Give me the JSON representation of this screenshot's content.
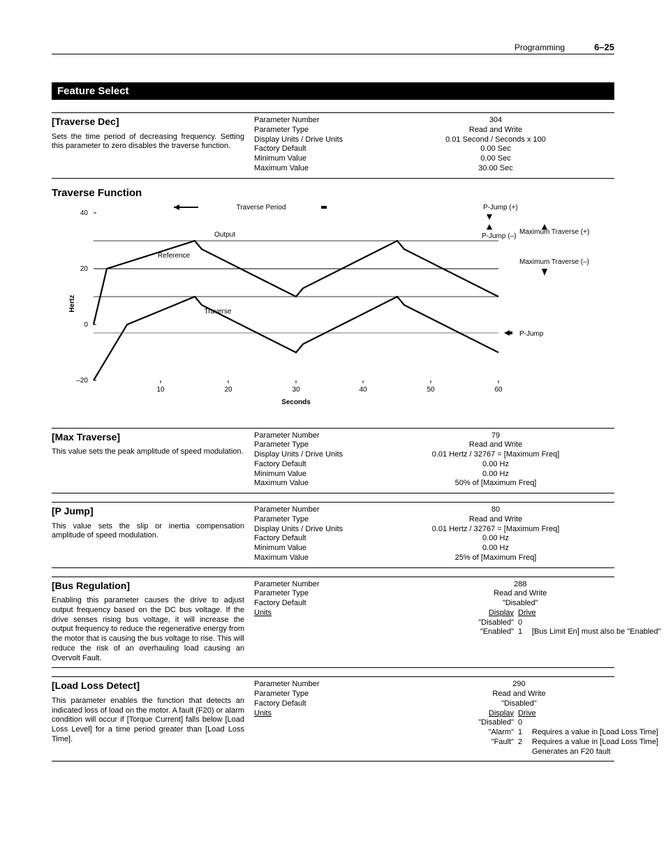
{
  "page_header": {
    "section": "Programming",
    "page_number": "6–25"
  },
  "feature_bar": "Feature Select",
  "traverse_dec": {
    "title": "[Traverse Dec]",
    "desc": "Sets the time period of decreasing frequency. Setting this parameter to zero disables the traverse function.",
    "labels": {
      "pn": "Parameter Number",
      "pt": "Parameter Type",
      "du": "Display Units / Drive Units",
      "fd": "Factory Default",
      "min": "Minimum Value",
      "max": "Maximum Value"
    },
    "values": {
      "pn": "304",
      "pt": "Read and Write",
      "du": "0.01 Second / Seconds x 100",
      "fd": "0.00 Sec",
      "min": "0.00 Sec",
      "max": "30.00 Sec"
    }
  },
  "diagram": {
    "title": "Traverse Function",
    "xlabel": "Seconds",
    "ylabel": "Hertz",
    "annotations": {
      "traverse_period": "Traverse Period",
      "output": "Output",
      "reference": "Reference",
      "traverse": "Traverse",
      "pjump_plus": "P-Jump (+)",
      "pjump_minus": "P-Jump (–)",
      "max_traverse_plus": "Maximum Traverse (+)",
      "max_traverse_minus": "Maximum Traverse (–)",
      "pjump": "P-Jump"
    },
    "yticks": [
      "–20",
      "0",
      "20",
      "40"
    ],
    "xticks": [
      "10",
      "20",
      "30",
      "40",
      "50",
      "60"
    ]
  },
  "max_traverse": {
    "title": "[Max Traverse]",
    "desc": "This value sets the peak amplitude of speed modulation.",
    "values": {
      "pn": "79",
      "pt": "Read and Write",
      "du": "0.01 Hertz / 32767 = [Maximum Freq]",
      "fd": "0.00 Hz",
      "min": "0.00 Hz",
      "max": "50% of [Maximum Freq]"
    }
  },
  "p_jump": {
    "title": "[P Jump]",
    "desc": "This value sets the slip or inertia compensation amplitude of speed modulation.",
    "values": {
      "pn": "80",
      "pt": "Read and Write",
      "du": "0.01 Hertz / 32767 = [Maximum Freq]",
      "fd": "0.00 Hz",
      "min": "0.00 Hz",
      "max": "25% of [Maximum Freq]"
    }
  },
  "bus_reg": {
    "title": "[Bus Regulation]",
    "desc": "Enabling this parameter causes the drive to adjust output frequency based on the DC bus voltage. If the drive senses rising bus voltage, it will increase the output frequency to reduce the regenerative energy from the motor that is causing the bus voltage to rise. This will reduce the risk of an overhauling load causing an Overvolt Fault.",
    "labels": {
      "units": "Units"
    },
    "values": {
      "pn": "288",
      "pt": "Read and Write",
      "fd": "\"Disabled\"",
      "units_h1": "Display",
      "units_h2": "Drive",
      "u0a": "\"Disabled\"",
      "u0b": "0",
      "u1a": "\"Enabled\"",
      "u1b": "1",
      "u1n": "[Bus Limit En] must also be \"Enabled\""
    }
  },
  "load_loss": {
    "title": "[Load Loss Detect]",
    "desc": "This parameter enables the function that detects an indicated loss of load on the motor. A fault (F20) or alarm condition will occur if [Torque Current] falls below [Load Loss Level] for a time period greater than [Load Loss Time].",
    "values": {
      "pn": "290",
      "pt": "Read and Write",
      "fd": "\"Disabled\"",
      "units_h1": "Display",
      "units_h2": "Drive",
      "u0a": "\"Disabled\"",
      "u0b": "0",
      "u1a": "\"Alarm\"",
      "u1b": "1",
      "u1n": "Requires a value in [Load Loss Time]",
      "u2a": "\"Fault\"",
      "u2b": "2",
      "u2n": "Requires a value in [Load Loss Time]",
      "u2n2": "Generates an F20 fault"
    }
  },
  "chart_data": {
    "type": "line",
    "xlabel": "Seconds",
    "ylabel": "Hertz",
    "x_range": [
      0,
      60
    ],
    "y_range": [
      -20,
      40
    ],
    "yticks": [
      -20,
      0,
      20,
      40
    ],
    "xticks": [
      10,
      20,
      30,
      40,
      50,
      60
    ],
    "series": [
      {
        "name": "Reference",
        "x": [
          0,
          60
        ],
        "y": [
          20,
          20
        ],
        "style": "thin"
      },
      {
        "name": "Maximum Traverse (+)",
        "x": [
          0,
          60
        ],
        "y": [
          30,
          30
        ],
        "style": "gray"
      },
      {
        "name": "Maximum Traverse (–)",
        "x": [
          0,
          60
        ],
        "y": [
          10,
          10
        ],
        "style": "gray"
      },
      {
        "name": "Output",
        "x": [
          0,
          2,
          15,
          16,
          30,
          31,
          45,
          46,
          60
        ],
        "y": [
          0,
          20,
          30,
          27,
          10,
          13,
          30,
          27,
          10
        ],
        "style": "thick"
      },
      {
        "name": "Traverse",
        "x": [
          0,
          5,
          15,
          16,
          30,
          31,
          45,
          46,
          60
        ],
        "y": [
          -20,
          0,
          10,
          7,
          -10,
          -7,
          10,
          7,
          -10
        ],
        "style": "thick"
      },
      {
        "name": "P-Jump",
        "x": [
          0,
          60
        ],
        "y": [
          -3,
          -3
        ],
        "style": "gray"
      }
    ]
  }
}
